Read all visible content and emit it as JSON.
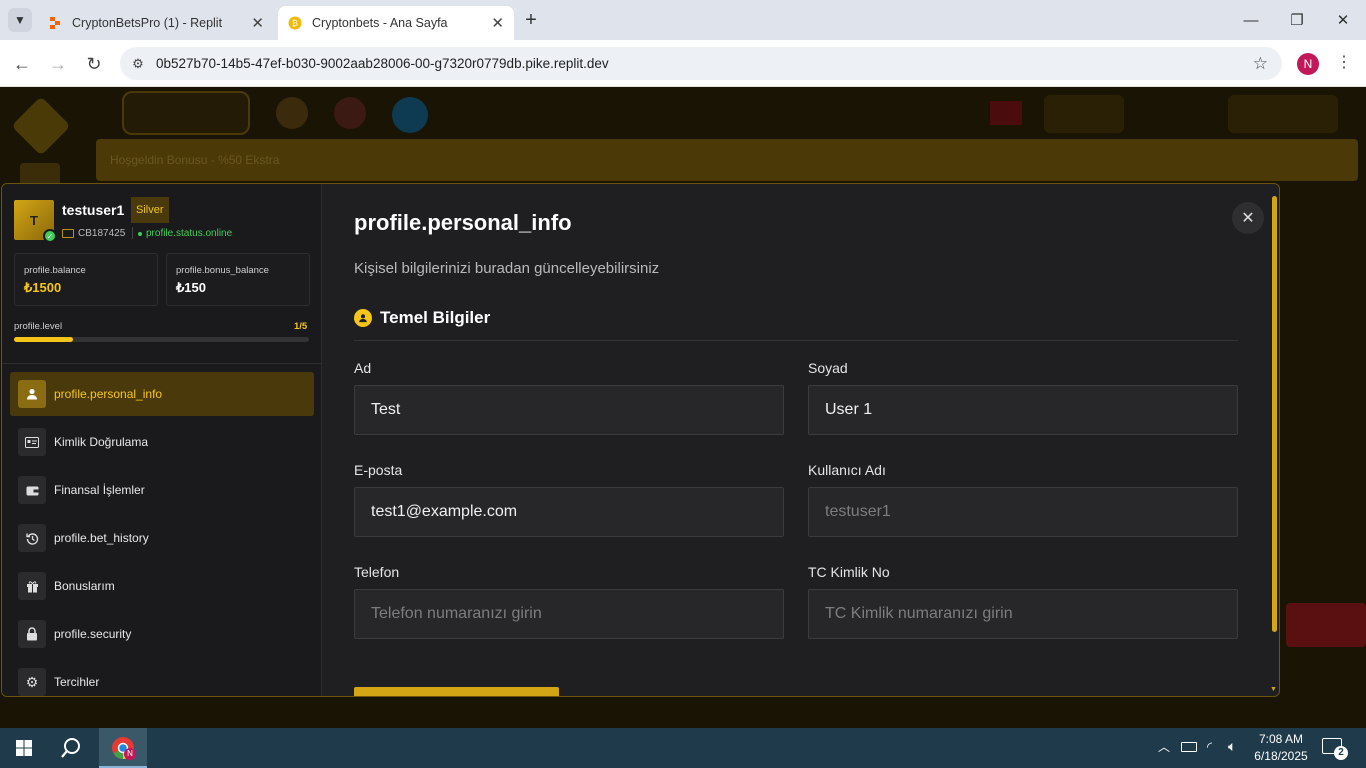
{
  "browser": {
    "tabs": [
      {
        "title": "CryptonBetsPro (1) - Replit",
        "active": false
      },
      {
        "title": "Cryptonbets - Ana Sayfa",
        "active": true
      }
    ],
    "url": "0b527b70-14b5-47ef-b030-9002aab28006-00-g7320r0779db.pike.replit.dev",
    "profile_initial": "N"
  },
  "background": {
    "banner_text": "Hoşgeldin Bonusu - %50 Ekstra"
  },
  "profile": {
    "avatar_initial": "T",
    "username": "testuser1",
    "tier": "Silver",
    "user_id": "CB187425",
    "status": "profile.status.online",
    "balance_label": "profile.balance",
    "balance_value": "₺1500",
    "bonus_label": "profile.bonus_balance",
    "bonus_value": "₺150",
    "level_label": "profile.level",
    "level_value": "1/5",
    "level_progress": 0.2
  },
  "menu": [
    {
      "label": "profile.personal_info",
      "icon": "user-icon",
      "active": true
    },
    {
      "label": "Kimlik Doğrulama",
      "icon": "id-card-icon",
      "active": false
    },
    {
      "label": "Finansal İşlemler",
      "icon": "wallet-icon",
      "active": false
    },
    {
      "label": "profile.bet_history",
      "icon": "history-icon",
      "active": false
    },
    {
      "label": "Bonuslarım",
      "icon": "gift-icon",
      "active": false
    },
    {
      "label": "profile.security",
      "icon": "lock-icon",
      "active": false
    },
    {
      "label": "Tercihler",
      "icon": "gear-icon",
      "active": false
    }
  ],
  "main": {
    "title": "profile.personal_info",
    "subtitle": "Kişisel bilgilerinizi buradan güncelleyebilirsiniz",
    "section_title": "Temel Bilgiler",
    "fields": {
      "first_name": {
        "label": "Ad",
        "value": "Test",
        "placeholder": ""
      },
      "last_name": {
        "label": "Soyad",
        "value": "User 1",
        "placeholder": ""
      },
      "email": {
        "label": "E-posta",
        "value": "test1@example.com",
        "placeholder": ""
      },
      "username": {
        "label": "Kullanıcı Adı",
        "value": "",
        "placeholder": "testuser1"
      },
      "phone": {
        "label": "Telefon",
        "value": "",
        "placeholder": "Telefon numaranızı girin"
      },
      "tc": {
        "label": "TC Kimlik No",
        "value": "",
        "placeholder": "TC Kimlik numaranızı girin"
      }
    }
  },
  "taskbar": {
    "time": "7:08 AM",
    "date": "6/18/2025",
    "notifications": "2"
  },
  "colors": {
    "accent": "#f5c518",
    "online": "#3ecf5a"
  }
}
